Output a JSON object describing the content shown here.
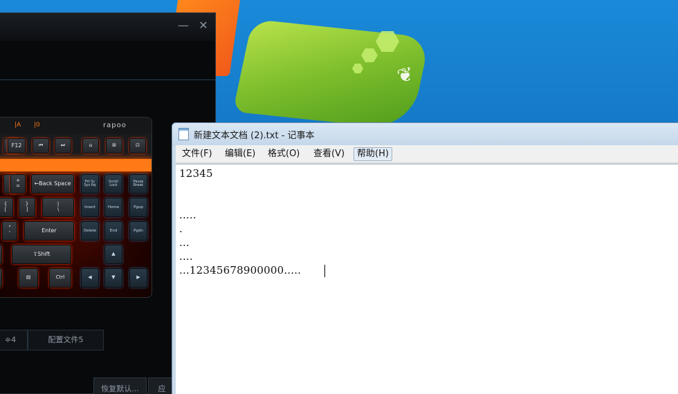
{
  "rapoo": {
    "brand": "rapoo",
    "indicators": [
      "|A",
      "|0"
    ],
    "keys": {
      "f12": "F12",
      "backspace": "←Back Space",
      "plus_equals": "+\n=",
      "prtsc": "Prt Sc\nSys Rq",
      "scroll": "Scroll\nLock",
      "pause": "Pause\nBreak",
      "brace": "{\n[",
      "brace_close": "}\n]",
      "pipe": "|\n\\",
      "insert": "Insert",
      "home": "Home",
      "pgup": "Pgup",
      "quote": "\"\n'",
      "enter": "Enter",
      "delete": "Delete",
      "end": "End",
      "pgdn": "Pgdn",
      "shift": "⇧Shift",
      "ctrl": "Ctrl"
    },
    "tabs": [
      "≑4",
      "配置文件5"
    ],
    "restore_button": "恢复默认...",
    "apply_button": "应"
  },
  "notepad": {
    "title": "新建文本文档 (2).txt - 记事本",
    "menu": [
      "文件(F)",
      "编辑(E)",
      "格式(O)",
      "查看(V)",
      "帮助(H)"
    ],
    "lines": [
      "12345",
      "",
      "",
      ".....",
      ".",
      "...",
      "....",
      "...12345678900000....."
    ]
  }
}
